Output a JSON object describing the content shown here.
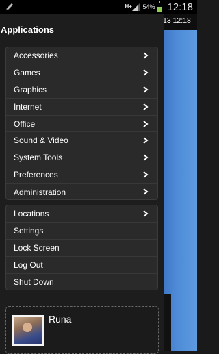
{
  "status_bar": {
    "network": "H+",
    "battery_percent": "54%",
    "battery_level": 0.54,
    "time": "12:18",
    "icons": [
      "pencil-icon",
      "signal-icon",
      "battery-icon"
    ]
  },
  "desktop": {
    "clock": "13 12:18",
    "colors": {
      "background": "#4f8cd8"
    }
  },
  "menu": {
    "title": "Applications",
    "categories": [
      {
        "label": "Accessories",
        "has_submenu": true
      },
      {
        "label": "Games",
        "has_submenu": true
      },
      {
        "label": "Graphics",
        "has_submenu": true
      },
      {
        "label": "Internet",
        "has_submenu": true
      },
      {
        "label": "Office",
        "has_submenu": true
      },
      {
        "label": "Sound & Video",
        "has_submenu": true
      },
      {
        "label": "System Tools",
        "has_submenu": true
      },
      {
        "label": "Preferences",
        "has_submenu": true
      },
      {
        "label": "Administration",
        "has_submenu": true
      }
    ],
    "session_items": [
      {
        "label": "Locations",
        "has_submenu": true
      },
      {
        "label": "Settings",
        "has_submenu": false
      },
      {
        "label": "Lock Screen",
        "has_submenu": false
      },
      {
        "label": "Log Out",
        "has_submenu": false
      },
      {
        "label": "Shut Down",
        "has_submenu": false
      }
    ]
  },
  "user": {
    "name": "Runa"
  }
}
